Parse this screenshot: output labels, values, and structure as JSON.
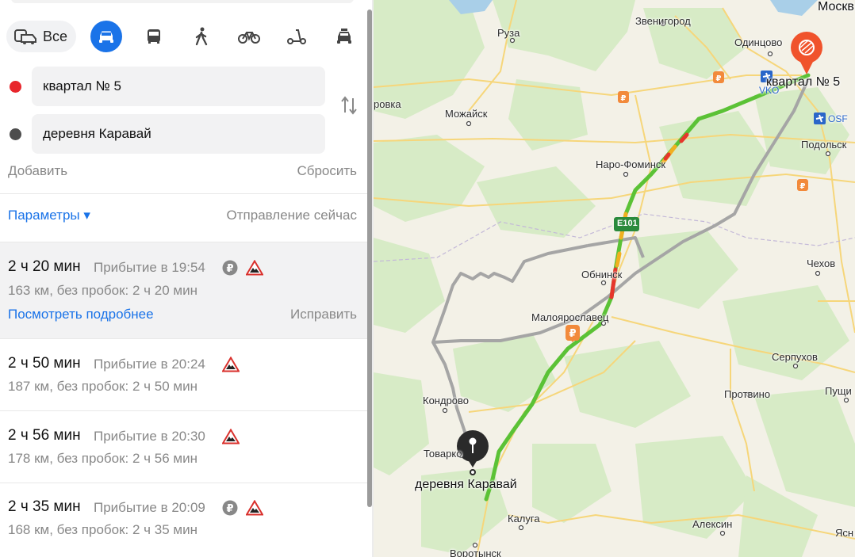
{
  "modes": {
    "all_label": "Все",
    "items": [
      {
        "name": "car-icon",
        "active": true
      },
      {
        "name": "bus-icon",
        "active": false
      },
      {
        "name": "pedestrian-icon",
        "active": false
      },
      {
        "name": "bicycle-icon",
        "active": false
      },
      {
        "name": "scooter-icon",
        "active": false
      },
      {
        "name": "taxi-icon",
        "active": false
      }
    ]
  },
  "points": {
    "from": {
      "value": "квартал № 5",
      "color": "#e8262c"
    },
    "to": {
      "value": "деревня Каравай",
      "color": "#4d4d4d"
    }
  },
  "actions": {
    "add": "Добавить",
    "reset": "Сбросить"
  },
  "params": {
    "label": "Параметры ▾",
    "departure": "Отправление сейчас"
  },
  "routes": [
    {
      "duration": "2 ч 20 мин",
      "arrival": "Прибытие в 19:54",
      "distance": "163 км, без пробок: 2 ч 20 мин",
      "toll": true,
      "road_warning": true,
      "selected": true,
      "details_link": "Посмотреть подробнее",
      "fix_link": "Исправить"
    },
    {
      "duration": "2 ч 50 мин",
      "arrival": "Прибытие в 20:24",
      "distance": "187 км, без пробок: 2 ч 50 мин",
      "toll": false,
      "road_warning": true,
      "selected": false
    },
    {
      "duration": "2 ч 56 мин",
      "arrival": "Прибытие в 20:30",
      "distance": "178 км, без пробок: 2 ч 56 мин",
      "toll": false,
      "road_warning": true,
      "selected": false
    },
    {
      "duration": "2 ч 35 мин",
      "arrival": "Прибытие в 20:09",
      "distance": "168 км, без пробок: 2 ч 35 мин",
      "toll": true,
      "road_warning": true,
      "selected": false
    }
  ],
  "map": {
    "labels": {
      "moscow": "Москв",
      "zvenigorod": "Звенигород",
      "ruza": "Руза",
      "odintsovo": "Одинцово",
      "mozhaisk": "Можайск",
      "naro_fominsk": "Наро-Фоминск",
      "podolsk": "Подольск",
      "obninsk": "Обнинск",
      "chekhov": "Чехов",
      "maloyaroslavets": "Малоярославец",
      "serpukhov": "Серпухов",
      "protvino": "Протвино",
      "kondrovo": "Кондрово",
      "tovarkovo": "Товарко",
      "kaluga": "Калуга",
      "aleksin": "Алексин",
      "vorotynsk": "Воротынск",
      "pushchino": "Пущи",
      "yasnogorsk": "Ясн",
      "ruza_side": "ровка",
      "vko": "VKO",
      "osf": "OSF",
      "highway": "E101",
      "start_label": "квартал № 5",
      "end_label": "деревня Каравай"
    },
    "colors": {
      "main_route": "#5bc236",
      "alt_route": "#a5a5a5",
      "start": "#f0532c",
      "end": "#2a2a2a"
    }
  }
}
